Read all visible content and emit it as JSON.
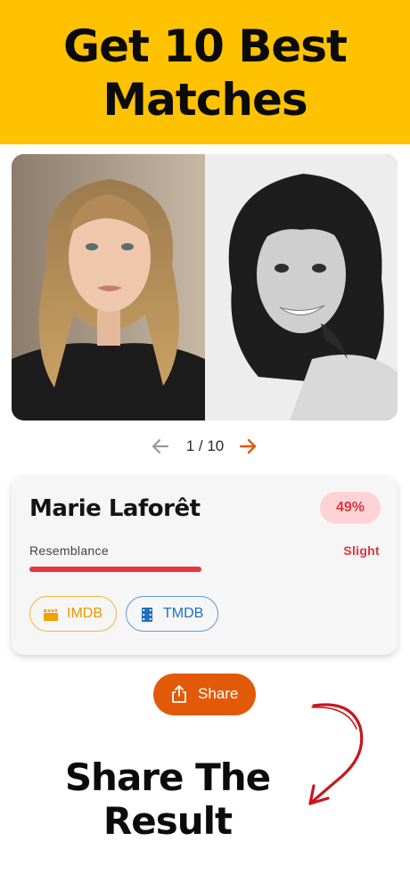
{
  "banner": {
    "line1": "Get 10 Best",
    "line2": "Matches"
  },
  "pager": {
    "current": "1",
    "total": "10",
    "text": "1 / 10"
  },
  "match": {
    "name": "Marie Laforêt",
    "percent": "49%",
    "resemblance_label": "Resemblance",
    "resemblance_level": "Slight",
    "resemblance_fraction": 0.49
  },
  "links": [
    {
      "label": "IMDB",
      "icon": "clapperboard-icon"
    },
    {
      "label": "TMDB",
      "icon": "film-strip-icon"
    }
  ],
  "share": {
    "label": "Share",
    "icon": "share-icon"
  },
  "footer": {
    "line1": "Share The",
    "line2": "Result"
  },
  "colors": {
    "banner_bg": "#FFC200",
    "accent_orange": "#E25A08",
    "badge_bg": "#FFD3D6",
    "badge_text": "#D9383F",
    "bar_fill": "#E8353C",
    "imdb": "#E59A00",
    "tmdb": "#1E6FBF",
    "arrow_red": "#C8161D"
  }
}
